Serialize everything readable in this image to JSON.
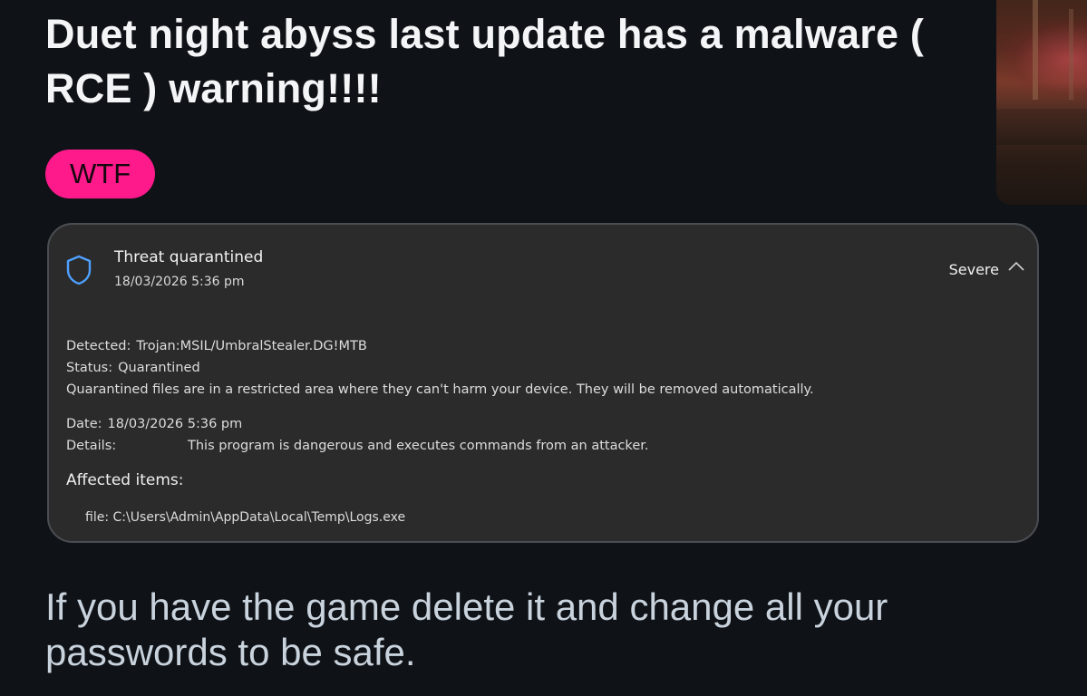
{
  "post": {
    "title": "Duet night abyss last update has a malware ( RCE ) warning!!!!",
    "flair": "WTF",
    "body": "If you have the game delete it and change all your passwords to be safe."
  },
  "notification": {
    "title": "Threat quarantined",
    "timestamp": "18/03/2026 5:36 pm",
    "severity": "Severe",
    "detected_label": "Detected:",
    "detected_value": "Trojan:MSIL/UmbralStealer.DG!MTB",
    "status_label": "Status:",
    "status_value": "Quarantined",
    "quarantine_note": "Quarantined files are in a restricted area where they can't harm your device. They will be removed automatically.",
    "date_label": "Date:",
    "date_value": "18/03/2026 5:36 pm",
    "details_label": "Details:",
    "details_value": "This program is dangerous and executes commands from an attacker.",
    "affected_label": "Affected items:",
    "file_path": "file: C:\\Users\\Admin\\AppData\\Local\\Temp\\Logs.exe"
  },
  "colors": {
    "flair_bg": "#ff1a8c",
    "shield_stroke": "#4ea1ff",
    "card_bg": "#2b2b2b",
    "page_bg": "#0f1216"
  },
  "icons": {
    "shield": "shield-icon",
    "chevron": "chevron-up-icon"
  }
}
